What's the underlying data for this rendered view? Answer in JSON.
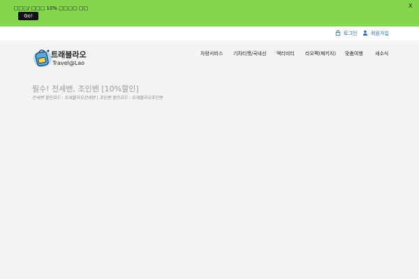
{
  "banner": {
    "text": "□□□/ □□□ 10% □□□□ □□",
    "button_label": "Go!",
    "close_label": "X",
    "bg_color": "#84d64e"
  },
  "topbar": {
    "login_label": "로그인",
    "login_icon": "lock-icon",
    "signup_label": "회원가입",
    "signup_icon": "user-icon",
    "link_color": "#2a6aa8"
  },
  "logo": {
    "kr": "트래블라오",
    "en": "Travel@Lao",
    "icon": "backpack-logo"
  },
  "nav": {
    "items": [
      {
        "label": "차량서비스"
      },
      {
        "label": "기차티켓/국내선"
      },
      {
        "label": "액티비티"
      },
      {
        "label": "라오팩(패키지)"
      },
      {
        "label": "맞춤여행"
      },
      {
        "label": "새소식"
      }
    ]
  },
  "main": {
    "title": "필수! 전세밴, 조인밴 [10%할인]",
    "subtitle": "전세밴 할인코드 : 트래블라오전세밴 | 조인밴 할인코드 : 트래블라오조인밴"
  }
}
